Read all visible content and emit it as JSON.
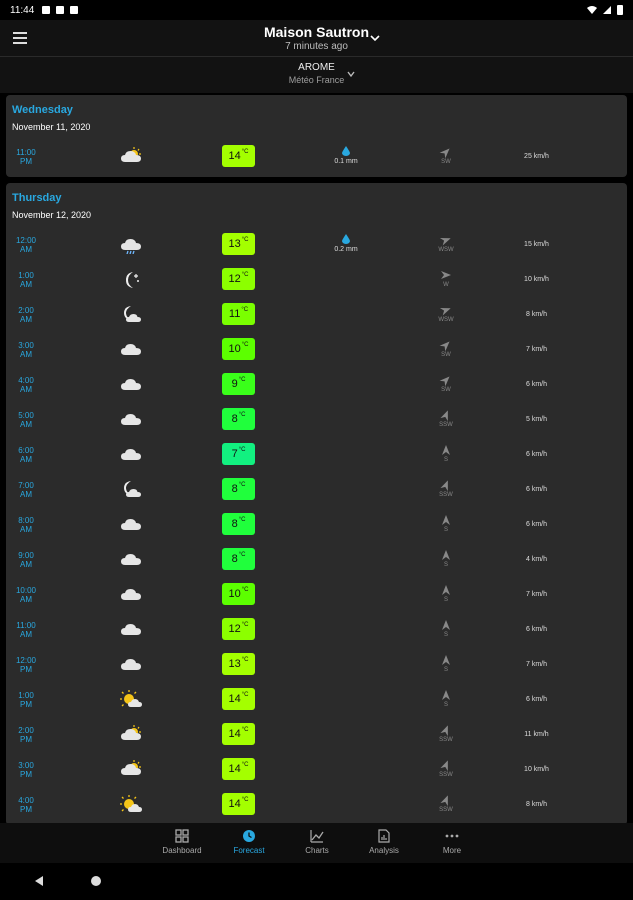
{
  "status_bar": {
    "time": "11:44"
  },
  "header": {
    "title": "Maison Sautron",
    "updated": "7 minutes ago"
  },
  "model": {
    "name": "AROME",
    "source": "Météo France"
  },
  "days": [
    {
      "day": "Wednesday",
      "date": "November 11, 2020",
      "rows": [
        {
          "time": "11:00\nPM",
          "icon": "cloud-sun-icon",
          "temp": "14",
          "unit": "°C",
          "color": "#a4ff00",
          "rain": "0.1 mm",
          "wind_dir": "SW",
          "arrow": 45,
          "wind": "25 km/h"
        }
      ]
    },
    {
      "day": "Thursday",
      "date": "November 12, 2020",
      "rows": [
        {
          "time": "12:00\nAM",
          "icon": "cloud-rain-icon",
          "temp": "13",
          "unit": "°C",
          "color": "#a4ff00",
          "rain": "0.2 mm",
          "wind_dir": "WSW",
          "arrow": 70,
          "wind": "15 km/h"
        },
        {
          "time": "1:00\nAM",
          "icon": "moon-stars-icon",
          "temp": "12",
          "unit": "°C",
          "color": "#8cff00",
          "rain": "",
          "wind_dir": "W",
          "arrow": 90,
          "wind": "10 km/h"
        },
        {
          "time": "2:00\nAM",
          "icon": "moon-cloud-icon",
          "temp": "11",
          "unit": "°C",
          "color": "#7aff00",
          "rain": "",
          "wind_dir": "WSW",
          "arrow": 70,
          "wind": "8 km/h"
        },
        {
          "time": "3:00\nAM",
          "icon": "cloud-icon",
          "temp": "10",
          "unit": "°C",
          "color": "#5cff00",
          "rain": "",
          "wind_dir": "SW",
          "arrow": 45,
          "wind": "7 km/h"
        },
        {
          "time": "4:00\nAM",
          "icon": "cloud-icon",
          "temp": "9",
          "unit": "°C",
          "color": "#3aff1a",
          "rain": "",
          "wind_dir": "SW",
          "arrow": 45,
          "wind": "6 km/h"
        },
        {
          "time": "5:00\nAM",
          "icon": "cloud-icon",
          "temp": "8",
          "unit": "°C",
          "color": "#20ff3c",
          "rain": "",
          "wind_dir": "SSW",
          "arrow": 22,
          "wind": "5 km/h"
        },
        {
          "time": "6:00\nAM",
          "icon": "cloud-icon",
          "temp": "7",
          "unit": "°C",
          "color": "#12f080",
          "rain": "",
          "wind_dir": "S",
          "arrow": 0,
          "wind": "6 km/h"
        },
        {
          "time": "7:00\nAM",
          "icon": "moon-cloud-icon",
          "temp": "8",
          "unit": "°C",
          "color": "#20ff3c",
          "rain": "",
          "wind_dir": "SSW",
          "arrow": 22,
          "wind": "6 km/h"
        },
        {
          "time": "8:00\nAM",
          "icon": "cloud-icon",
          "temp": "8",
          "unit": "°C",
          "color": "#20ff3c",
          "rain": "",
          "wind_dir": "S",
          "arrow": 0,
          "wind": "6 km/h"
        },
        {
          "time": "9:00\nAM",
          "icon": "cloud-icon",
          "temp": "8",
          "unit": "°C",
          "color": "#20ff3c",
          "rain": "",
          "wind_dir": "S",
          "arrow": 0,
          "wind": "4 km/h"
        },
        {
          "time": "10:00\nAM",
          "icon": "cloud-icon",
          "temp": "10",
          "unit": "°C",
          "color": "#5cff00",
          "rain": "",
          "wind_dir": "S",
          "arrow": 0,
          "wind": "7 km/h"
        },
        {
          "time": "11:00\nAM",
          "icon": "cloud-icon",
          "temp": "12",
          "unit": "°C",
          "color": "#8cff00",
          "rain": "",
          "wind_dir": "S",
          "arrow": 0,
          "wind": "6 km/h"
        },
        {
          "time": "12:00\nPM",
          "icon": "cloud-icon",
          "temp": "13",
          "unit": "°C",
          "color": "#a4ff00",
          "rain": "",
          "wind_dir": "S",
          "arrow": 0,
          "wind": "7 km/h"
        },
        {
          "time": "1:00\nPM",
          "icon": "sun-cloud-icon",
          "temp": "14",
          "unit": "°C",
          "color": "#a4ff00",
          "rain": "",
          "wind_dir": "S",
          "arrow": 0,
          "wind": "6 km/h"
        },
        {
          "time": "2:00\nPM",
          "icon": "cloud-sun-icon",
          "temp": "14",
          "unit": "°C",
          "color": "#a4ff00",
          "rain": "",
          "wind_dir": "SSW",
          "arrow": 22,
          "wind": "11 km/h"
        },
        {
          "time": "3:00\nPM",
          "icon": "cloud-sun-icon",
          "temp": "14",
          "unit": "°C",
          "color": "#a4ff00",
          "rain": "",
          "wind_dir": "SSW",
          "arrow": 22,
          "wind": "10 km/h"
        },
        {
          "time": "4:00\nPM",
          "icon": "sun-cloud-icon",
          "temp": "14",
          "unit": "°C",
          "color": "#a4ff00",
          "rain": "",
          "wind_dir": "SSW",
          "arrow": 22,
          "wind": "8 km/h"
        }
      ]
    }
  ],
  "nav": [
    {
      "label": "Dashboard",
      "icon": "dashboard-icon",
      "active": false
    },
    {
      "label": "Forecast",
      "icon": "clock-icon",
      "active": true
    },
    {
      "label": "Charts",
      "icon": "chart-icon",
      "active": false
    },
    {
      "label": "Analysis",
      "icon": "document-chart-icon",
      "active": false
    },
    {
      "label": "More",
      "icon": "more-icon",
      "active": false
    }
  ],
  "colors": {
    "accent": "#29a8e0",
    "card": "#2b2b2b"
  }
}
